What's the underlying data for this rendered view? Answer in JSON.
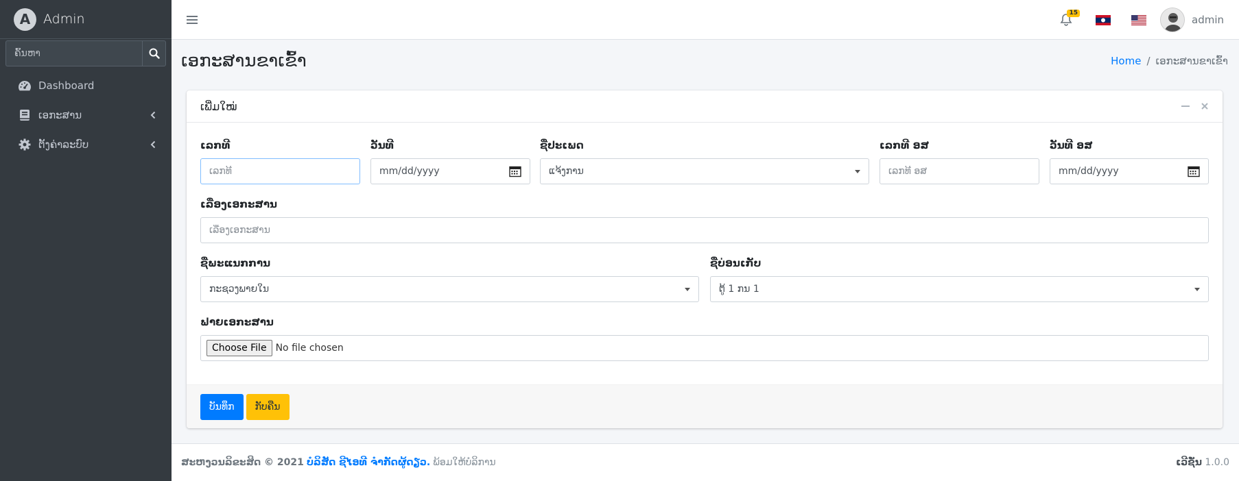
{
  "brand": {
    "title": "Admin",
    "logo_letter": "A"
  },
  "sidebar": {
    "search_placeholder": "ຄົ້ນຫາ",
    "items": [
      {
        "label": "Dashboard",
        "icon": "gauge-icon"
      },
      {
        "label": "ເອກະສານ",
        "icon": "book-icon"
      },
      {
        "label": "ຕັ້ງຄ່າລະບົບ",
        "icon": "gear-icon"
      }
    ]
  },
  "topbar": {
    "notification_count": "15",
    "user_name": "admin"
  },
  "header": {
    "title": "ເອກະສານຂາເຂົ້າ",
    "breadcrumb_home": "Home",
    "breadcrumb_sep": "/",
    "breadcrumb_current": "ເອກະສານຂາເຂົ້າ"
  },
  "card": {
    "title": "ເພີ່ມໃໝ່",
    "fields": {
      "number": {
        "label": "ເລກທີ",
        "placeholder": "ເລກທີ"
      },
      "date": {
        "label": "ວັນທີ",
        "placeholder": "mm/dd/yyyy"
      },
      "type": {
        "label": "ຊື່ປະເພດ",
        "value": "ແຈ້ງການ"
      },
      "out_number": {
        "label": "ເລກທີ ອສ",
        "placeholder": "ເລກທີ ອສ"
      },
      "out_date": {
        "label": "ວັນທີ ອສ",
        "placeholder": "mm/dd/yyyy"
      },
      "subject": {
        "label": "ເລື່ອງເອກະສານ",
        "placeholder": "ເລື່ອງເອກະສານ"
      },
      "department": {
        "label": "ຊື່ພະແນກການ",
        "value": "ກະຊວງພາຍໃນ"
      },
      "storage": {
        "label": "ຊື່ບ່ອນເກັບ",
        "value": "ຕູ້ 1 ກນ 1"
      },
      "file": {
        "label": "ຟາຍເອກະສານ",
        "button": "Choose File",
        "status": "No file chosen"
      }
    },
    "save_label": "ບັນທຶກ",
    "back_label": "ກັບຄືນ"
  },
  "footer": {
    "copyright": "ສະຫງວນລິຂະສິດ © 2021",
    "company": "ບໍລິສັດ ຊີໄອທີ ຈໍາກັດຜູ້ດຽວ.",
    "rights": "ພ້ອມໃຫ້ບໍລິການ",
    "version_label": "ເວີຊັ່ນ",
    "version": "1.0.0"
  },
  "colors": {
    "sidebar": "#343a40",
    "primary": "#007bff",
    "warning": "#ffc107"
  }
}
